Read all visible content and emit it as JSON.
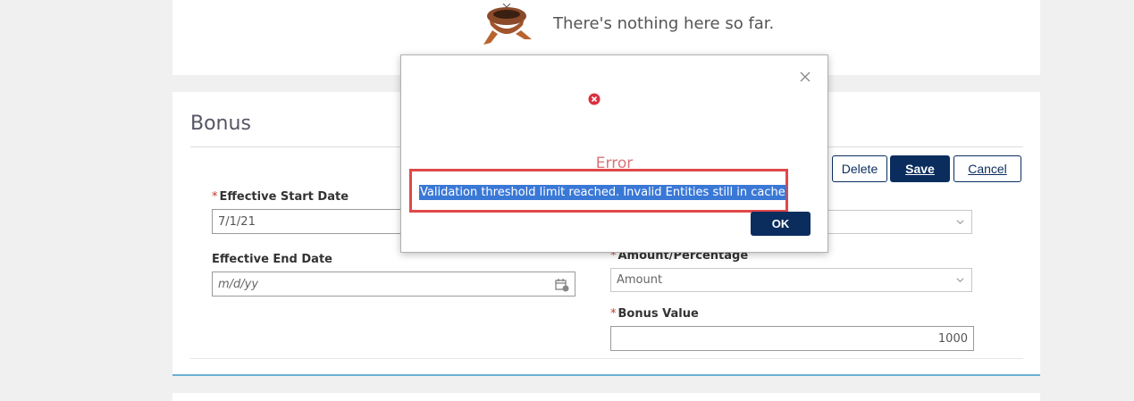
{
  "empty_state": {
    "message": "There's nothing here so far.",
    "icon": "nest-icon"
  },
  "bonus": {
    "title": "Bonus",
    "buttons": {
      "delete_label": "Delete",
      "save_label": "Save",
      "cancel_label": "Cancel"
    },
    "fields": {
      "start_date": {
        "label": "Effective Start Date",
        "required_mark": "*",
        "value": "7/1/21"
      },
      "end_date": {
        "label": "Effective End Date",
        "placeholder": "m/d/yy"
      },
      "amount_percentage": {
        "label": "Amount/Percentage",
        "required_mark": "*",
        "value": "Amount"
      },
      "bonus_value": {
        "label": "Bonus Value",
        "required_mark": "*",
        "value": "1000"
      }
    }
  },
  "dialog": {
    "title": "Error",
    "message": "Validation threshold limit reached. Invalid Entities still in cache",
    "ok_label": "OK"
  },
  "colors": {
    "primary": "#0a2d5e",
    "error_title": "#d9757a",
    "highlight": "#e04848",
    "selection": "#3a78d6"
  }
}
